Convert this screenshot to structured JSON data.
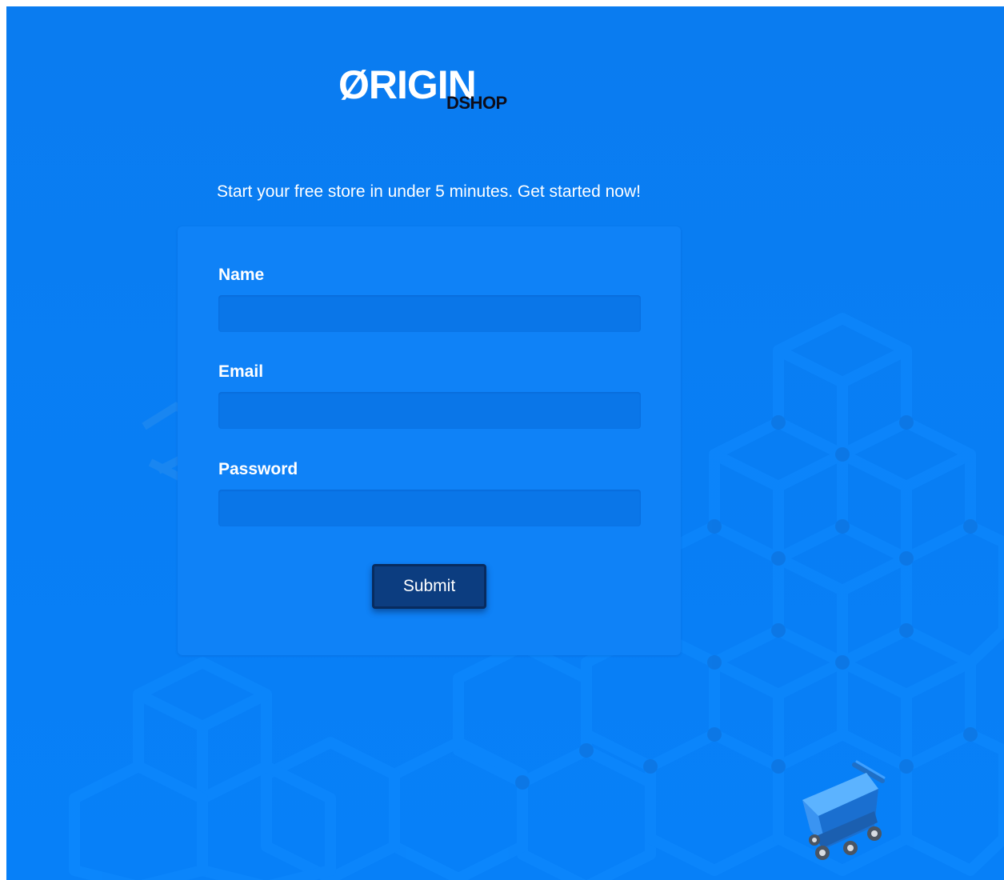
{
  "brand": {
    "logo_main": "ØRIGIN",
    "logo_sub": "DSHOP"
  },
  "tagline": "Start your free store in under 5 minutes. Get started now!",
  "form": {
    "name_label": "Name",
    "name_value": "",
    "email_label": "Email",
    "email_value": "",
    "password_label": "Password",
    "password_value": "",
    "submit_label": "Submit"
  },
  "colors": {
    "background": "#0a7cf0",
    "card": "#0f82f7",
    "input": "#0a76e8",
    "button": "#0c3d80",
    "text": "#ffffff"
  },
  "decorations": {
    "background_pattern": "isometric-cubes",
    "cart_icon": "shopping-cart-icon"
  }
}
